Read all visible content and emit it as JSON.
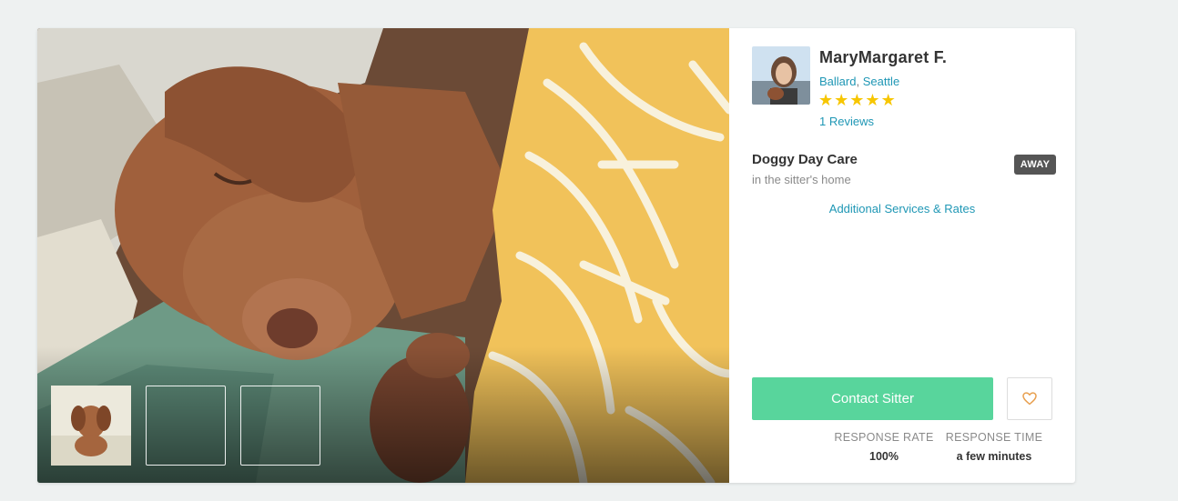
{
  "sitter": {
    "name": "MaryMargaret F.",
    "neighborhood": "Ballard",
    "location_sep": ", ",
    "city": "Seattle",
    "rating_stars": 5,
    "reviews_label": "1 Reviews"
  },
  "service": {
    "title": "Doggy Day Care",
    "subtitle": "in the sitter's home",
    "status_badge": "AWAY",
    "additional_link": "Additional Services & Rates"
  },
  "actions": {
    "contact_label": "Contact Sitter",
    "favorite_icon": "heart-outline-icon"
  },
  "stats": {
    "response_rate_label": "RESPONSE RATE",
    "response_rate_value": "100%",
    "response_time_label": "RESPONSE TIME",
    "response_time_value": "a few minutes"
  },
  "gallery": {
    "thumbnails": [
      "sitter-with-dog-photo",
      "dog-on-couch-photo",
      "dog-on-bed-photo"
    ]
  },
  "colors": {
    "accent_link": "#1f97b5",
    "contact_button": "#58d59c",
    "star": "#f7c600",
    "badge": "#555555",
    "heart": "#e8a050"
  }
}
